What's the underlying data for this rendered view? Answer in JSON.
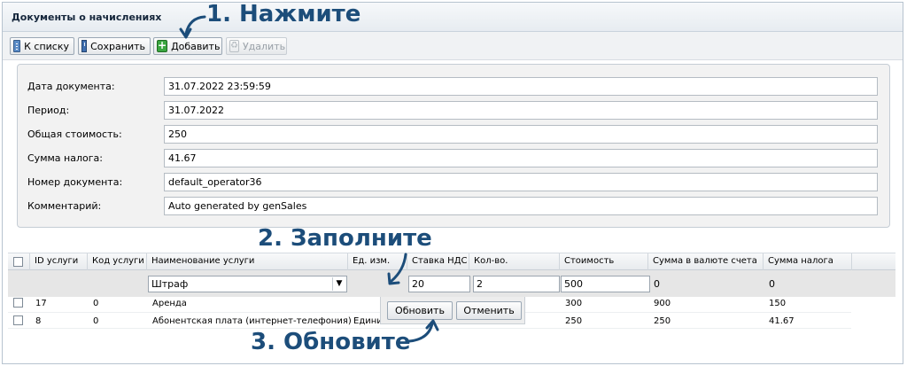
{
  "window": {
    "title": "Документы о начислениях"
  },
  "toolbar": {
    "back_label": "К списку",
    "save_label": "Сохранить",
    "add_label": "Добавить",
    "delete_label": "Удалить"
  },
  "form": {
    "fields": [
      {
        "label": "Дата документа:",
        "value": "31.07.2022 23:59:59"
      },
      {
        "label": "Период:",
        "value": "31.07.2022"
      },
      {
        "label": "Общая стоимость:",
        "value": "250"
      },
      {
        "label": "Сумма налога:",
        "value": "41.67"
      },
      {
        "label": "Номер документа:",
        "value": "default_operator36"
      },
      {
        "label": "Комментарий:",
        "value": "Auto generated by genSales"
      }
    ]
  },
  "grid": {
    "columns": [
      "ID услуги",
      "Код услуги",
      "Наименование услуги",
      "Ед. изм.",
      "Ставка НДС",
      "Кол-во.",
      "Стоимость",
      "Сумма в валюте счета",
      "Сумма налога"
    ],
    "edit_row": {
      "service": "Штраф",
      "vat": "20",
      "qty": "2",
      "cost": "500",
      "sum_currency": "0",
      "tax": "0"
    },
    "rows": [
      {
        "id": "17",
        "code": "0",
        "name": "Аренда",
        "unit": "",
        "cost": "300",
        "sum": "900",
        "tax": "150"
      },
      {
        "id": "8",
        "code": "0",
        "name": "Абонентская плата (интернет-телефония)",
        "unit": "Едини",
        "cost": "250",
        "sum": "250",
        "tax": "41.67"
      }
    ]
  },
  "popup": {
    "update_label": "Обновить",
    "cancel_label": "Отменить"
  },
  "annotations": {
    "step1": "1. Нажмите",
    "step2": "2. Заполните",
    "step3": "3. Обновите"
  },
  "colors": {
    "annotation": "#1c4d7a",
    "accent": "#3aa640"
  }
}
